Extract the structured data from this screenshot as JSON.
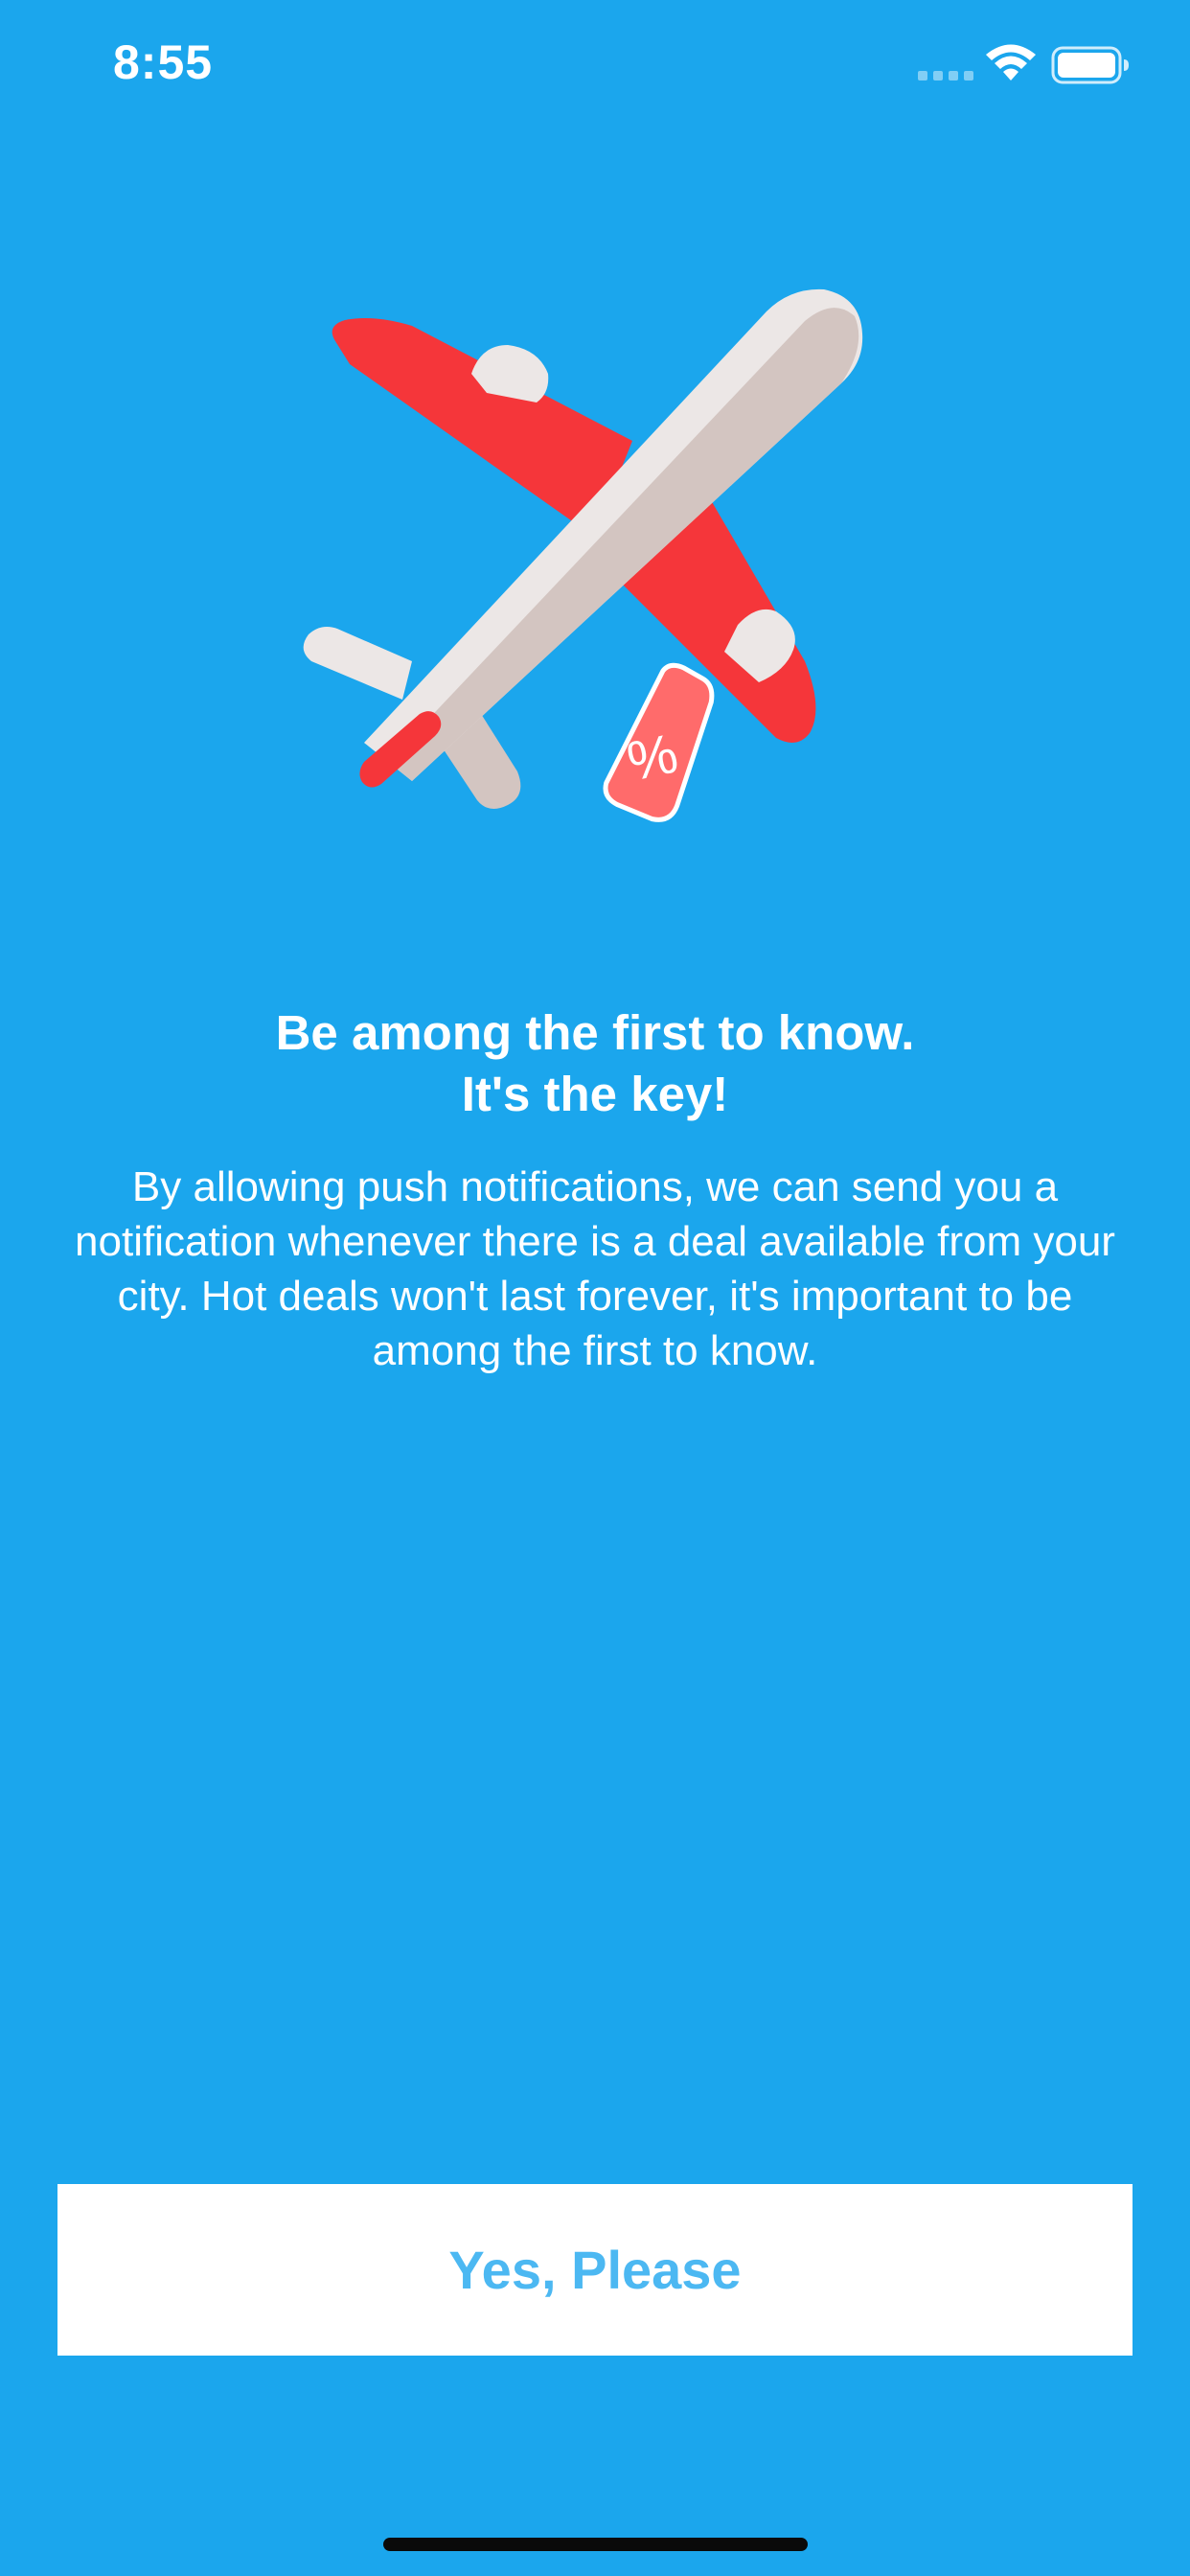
{
  "status_bar": {
    "time": "8:55",
    "signal_icon": "cellular-signal-icon",
    "wifi_icon": "wifi-icon",
    "battery_icon": "battery-icon"
  },
  "illustration": {
    "icon": "airplane-discount-tag-icon",
    "tag_symbol": "%"
  },
  "headline": "Be among the first to know.\nIt's the key!",
  "description": "By allowing push notifications, we can send you a notification whenever there is a deal available from your city. Hot deals won't last forever, it's important to be among the first to know.",
  "cta_button": {
    "label": "Yes, Please"
  },
  "colors": {
    "background": "#1ba6ed",
    "button_background": "#ffffff",
    "button_text": "#4cb8f2",
    "plane_body": "#ece7e6",
    "plane_shadow": "#d3c5c1",
    "plane_wing": "#f5363a",
    "tag": "#ff6b6b"
  }
}
